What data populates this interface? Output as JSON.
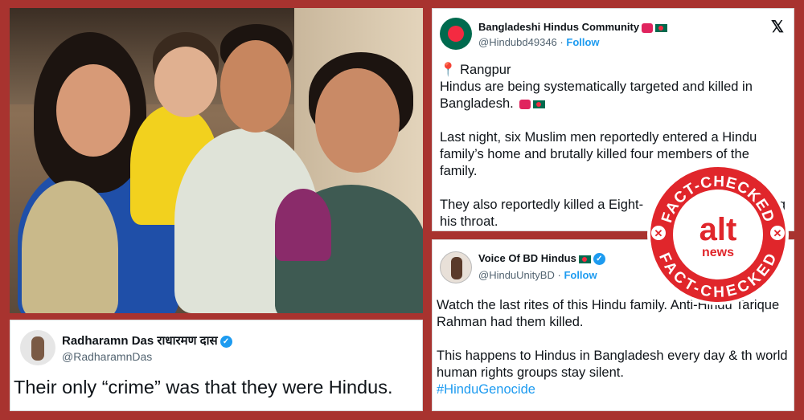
{
  "tweet_top": {
    "name": "Bangladeshi Hindus Community",
    "handle": "@Hindubd49346",
    "separator": "·",
    "follow": "Follow",
    "location": "Rangpur",
    "line1": "Hindus are being systematically targeted and killed in",
    "line2": "Bangladesh.",
    "para2": "Last night, six Muslim men reportedly entered a Hindu family’s home and brutally killed four members of the family.",
    "para3_a": "They also reportedly killed a Eight-",
    "para3_b": "ing",
    "para3_c": "his throat."
  },
  "tweet_right": {
    "name": "Voice Of BD Hindus",
    "handle": "@HinduUnityBD",
    "separator": "·",
    "follow": "Follow",
    "para1": "Watch the last rites of this Hindu family. Anti-Hindu Tarique Rahman had them killed.",
    "para2": "This happens to Hindus in Bangladesh every day & th world human rights groups stay silent.",
    "hashtag": "#HinduGenocide"
  },
  "tweet_left": {
    "name": "Radharamn Das राधारमण दास",
    "handle": "@RadharamnDas",
    "text": "Their only “crime” was that they were Hindus."
  },
  "badge": {
    "top_text": "FACT-CHECKED",
    "bottom_text": "FACT-CHECKED",
    "logo_main": "alt",
    "logo_sub": "news"
  },
  "colors": {
    "background": "#a8332f",
    "badge_red": "#e0262b",
    "link_blue": "#1d9bf0"
  }
}
